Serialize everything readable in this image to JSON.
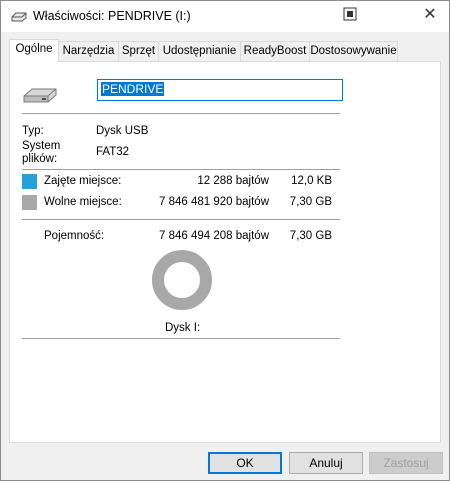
{
  "window": {
    "title": "Właściwości: PENDRIVE (I:)",
    "title_icon": "drive-icon",
    "help_icon": "help-icon",
    "close_glyph": "✕"
  },
  "tabs": [
    {
      "label": "Ogólne",
      "active": true
    },
    {
      "label": "Narzędzia",
      "active": false
    },
    {
      "label": "Sprzęt",
      "active": false
    },
    {
      "label": "Udostępnianie",
      "active": false
    },
    {
      "label": "ReadyBoost",
      "active": false
    },
    {
      "label": "Dostosowywanie",
      "active": false
    }
  ],
  "general": {
    "drive_name": "PENDRIVE",
    "type_label": "Typ:",
    "type_value": "Dysk USB",
    "fs_label_line1": "System",
    "fs_label_line2": "plików:",
    "fs_value": "FAT32",
    "used_label": "Zajęte miejsce:",
    "used_bytes": "12 288 bajtów",
    "used_human": "12,0 KB",
    "free_label": "Wolne miejsce:",
    "free_bytes": "7 846 481 920 bajtów",
    "free_human": "7,30 GB",
    "capacity_label": "Pojemność:",
    "capacity_bytes": "7 846 494 208 bajtów",
    "capacity_human": "7,30 GB",
    "disk_label": "Dysk I:",
    "used_fraction": 1.6e-06
  },
  "colors": {
    "used": "#26a0da",
    "free": "#a8a8a8",
    "accent": "#0078d7"
  },
  "buttons": {
    "ok": "OK",
    "cancel": "Anuluj",
    "apply": "Zastosuj"
  }
}
